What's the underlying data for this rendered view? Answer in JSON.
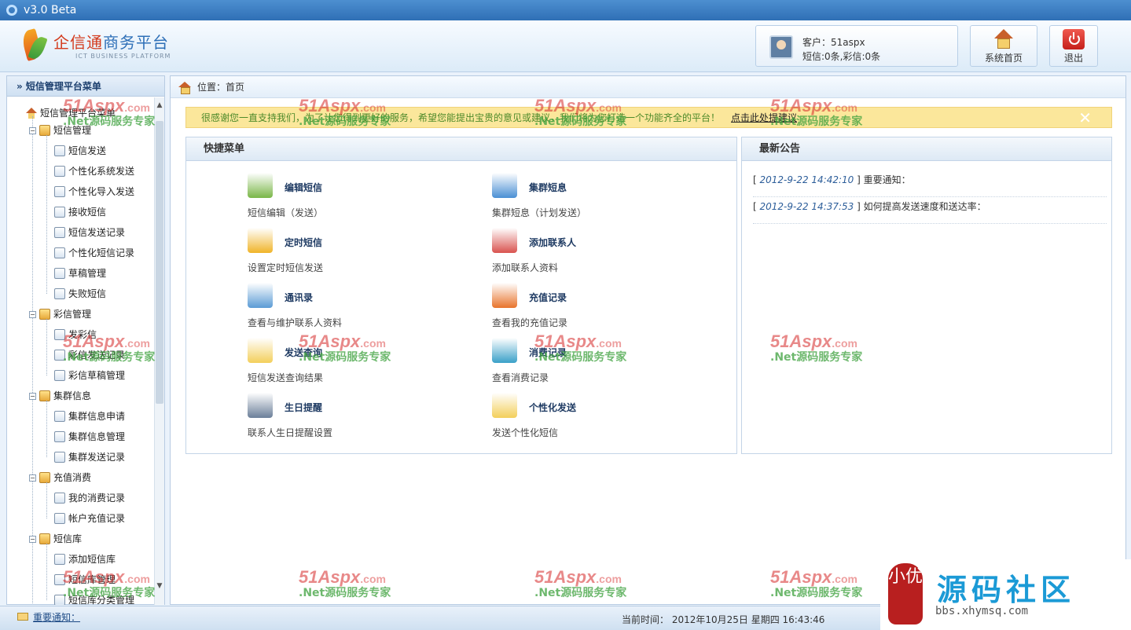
{
  "titlebar": {
    "version": "v3.0  Beta"
  },
  "header": {
    "logo_cn_a": "企信通",
    "logo_cn_b": "商务平台",
    "logo_en": "ICT BUSINESS PLATFORM",
    "user_label": "客户：51aspx",
    "user_quota": "短信:0条,彩信:0条",
    "home_label": "系统首页",
    "exit_label": "退出"
  },
  "sidebar": {
    "title": "» 短信管理平台菜单",
    "root": "短信管理平台菜单",
    "groups": [
      {
        "label": "短信管理",
        "items": [
          "短信发送",
          "个性化系统发送",
          "个性化导入发送",
          "接收短信",
          "短信发送记录",
          "个性化短信记录",
          "草稿管理",
          "失败短信"
        ]
      },
      {
        "label": "彩信管理",
        "items": [
          "发彩信",
          "彩信发送记录",
          "彩信草稿管理"
        ]
      },
      {
        "label": "集群信息",
        "items": [
          "集群信息申请",
          "集群信息管理",
          "集群发送记录"
        ]
      },
      {
        "label": "充值消费",
        "items": [
          "我的消费记录",
          "帐户充值记录"
        ]
      },
      {
        "label": "短信库",
        "items": [
          "添加短信库",
          "短信库管理",
          "短信库分类管理"
        ]
      }
    ]
  },
  "main": {
    "crumb": "位置：首页",
    "notice_text": "很感谢您一直支持我们，为了让您得到更好的服务，希望您能提出宝贵的意见或建议，我们将为您打造一个功能齐全的平台！",
    "notice_link": "点击此处提建议",
    "notice_close": "✕",
    "quick_title": "快捷菜单",
    "quick_items": [
      {
        "title": "编辑短信",
        "desc": "短信编辑（发送）",
        "color": "#7ab648"
      },
      {
        "title": "集群短息",
        "desc": "集群短息（计划发送）",
        "color": "#4a8fd4"
      },
      {
        "title": "定时短信",
        "desc": "设置定时短信发送",
        "color": "#f0b429"
      },
      {
        "title": "添加联系人",
        "desc": "添加联系人资料",
        "color": "#d9534f"
      },
      {
        "title": "通讯录",
        "desc": "查看与维护联系人资料",
        "color": "#5b9bd5"
      },
      {
        "title": "充值记录",
        "desc": "查看我的充值记录",
        "color": "#e8742c"
      },
      {
        "title": "发送查询",
        "desc": "短信发送查询结果",
        "color": "#f3cf5b"
      },
      {
        "title": "消费记录",
        "desc": "查看消费记录",
        "color": "#3aa0c8"
      },
      {
        "title": "生日提醒",
        "desc": "联系人生日提醒设置",
        "color": "#6b7f99"
      },
      {
        "title": "个性化发送",
        "desc": "发送个性化短信",
        "color": "#f3cf5b"
      }
    ],
    "news_title": "最新公告",
    "news": [
      {
        "date": "2012-9-22 14:42:10",
        "title": "重要通知："
      },
      {
        "date": "2012-9-22 14:37:53",
        "title": "如何提高发送速度和送达率："
      }
    ]
  },
  "footer": {
    "notice": "重要通知：",
    "time": "当前时间： 2012年10月25日 星期四 16:43:46"
  },
  "watermark": {
    "site_name": "源码社区",
    "site_url": "bbs.xhymsq.com",
    "seal": "小优",
    "brand": "51Aspx",
    "brand_suffix": ".com",
    "slogan": ".Net源码服务专家"
  }
}
